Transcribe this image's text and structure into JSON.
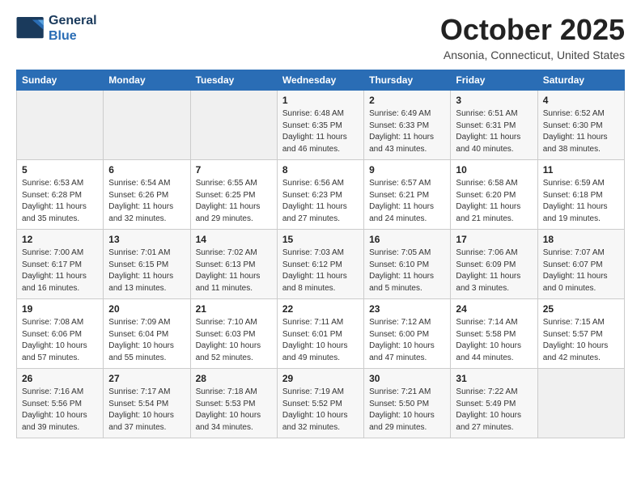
{
  "header": {
    "logo_line1": "General",
    "logo_line2": "Blue",
    "month": "October 2025",
    "location": "Ansonia, Connecticut, United States"
  },
  "days_of_week": [
    "Sunday",
    "Monday",
    "Tuesday",
    "Wednesday",
    "Thursday",
    "Friday",
    "Saturday"
  ],
  "weeks": [
    [
      {
        "day": "",
        "info": ""
      },
      {
        "day": "",
        "info": ""
      },
      {
        "day": "",
        "info": ""
      },
      {
        "day": "1",
        "info": "Sunrise: 6:48 AM\nSunset: 6:35 PM\nDaylight: 11 hours\nand 46 minutes."
      },
      {
        "day": "2",
        "info": "Sunrise: 6:49 AM\nSunset: 6:33 PM\nDaylight: 11 hours\nand 43 minutes."
      },
      {
        "day": "3",
        "info": "Sunrise: 6:51 AM\nSunset: 6:31 PM\nDaylight: 11 hours\nand 40 minutes."
      },
      {
        "day": "4",
        "info": "Sunrise: 6:52 AM\nSunset: 6:30 PM\nDaylight: 11 hours\nand 38 minutes."
      }
    ],
    [
      {
        "day": "5",
        "info": "Sunrise: 6:53 AM\nSunset: 6:28 PM\nDaylight: 11 hours\nand 35 minutes."
      },
      {
        "day": "6",
        "info": "Sunrise: 6:54 AM\nSunset: 6:26 PM\nDaylight: 11 hours\nand 32 minutes."
      },
      {
        "day": "7",
        "info": "Sunrise: 6:55 AM\nSunset: 6:25 PM\nDaylight: 11 hours\nand 29 minutes."
      },
      {
        "day": "8",
        "info": "Sunrise: 6:56 AM\nSunset: 6:23 PM\nDaylight: 11 hours\nand 27 minutes."
      },
      {
        "day": "9",
        "info": "Sunrise: 6:57 AM\nSunset: 6:21 PM\nDaylight: 11 hours\nand 24 minutes."
      },
      {
        "day": "10",
        "info": "Sunrise: 6:58 AM\nSunset: 6:20 PM\nDaylight: 11 hours\nand 21 minutes."
      },
      {
        "day": "11",
        "info": "Sunrise: 6:59 AM\nSunset: 6:18 PM\nDaylight: 11 hours\nand 19 minutes."
      }
    ],
    [
      {
        "day": "12",
        "info": "Sunrise: 7:00 AM\nSunset: 6:17 PM\nDaylight: 11 hours\nand 16 minutes."
      },
      {
        "day": "13",
        "info": "Sunrise: 7:01 AM\nSunset: 6:15 PM\nDaylight: 11 hours\nand 13 minutes."
      },
      {
        "day": "14",
        "info": "Sunrise: 7:02 AM\nSunset: 6:13 PM\nDaylight: 11 hours\nand 11 minutes."
      },
      {
        "day": "15",
        "info": "Sunrise: 7:03 AM\nSunset: 6:12 PM\nDaylight: 11 hours\nand 8 minutes."
      },
      {
        "day": "16",
        "info": "Sunrise: 7:05 AM\nSunset: 6:10 PM\nDaylight: 11 hours\nand 5 minutes."
      },
      {
        "day": "17",
        "info": "Sunrise: 7:06 AM\nSunset: 6:09 PM\nDaylight: 11 hours\nand 3 minutes."
      },
      {
        "day": "18",
        "info": "Sunrise: 7:07 AM\nSunset: 6:07 PM\nDaylight: 11 hours\nand 0 minutes."
      }
    ],
    [
      {
        "day": "19",
        "info": "Sunrise: 7:08 AM\nSunset: 6:06 PM\nDaylight: 10 hours\nand 57 minutes."
      },
      {
        "day": "20",
        "info": "Sunrise: 7:09 AM\nSunset: 6:04 PM\nDaylight: 10 hours\nand 55 minutes."
      },
      {
        "day": "21",
        "info": "Sunrise: 7:10 AM\nSunset: 6:03 PM\nDaylight: 10 hours\nand 52 minutes."
      },
      {
        "day": "22",
        "info": "Sunrise: 7:11 AM\nSunset: 6:01 PM\nDaylight: 10 hours\nand 49 minutes."
      },
      {
        "day": "23",
        "info": "Sunrise: 7:12 AM\nSunset: 6:00 PM\nDaylight: 10 hours\nand 47 minutes."
      },
      {
        "day": "24",
        "info": "Sunrise: 7:14 AM\nSunset: 5:58 PM\nDaylight: 10 hours\nand 44 minutes."
      },
      {
        "day": "25",
        "info": "Sunrise: 7:15 AM\nSunset: 5:57 PM\nDaylight: 10 hours\nand 42 minutes."
      }
    ],
    [
      {
        "day": "26",
        "info": "Sunrise: 7:16 AM\nSunset: 5:56 PM\nDaylight: 10 hours\nand 39 minutes."
      },
      {
        "day": "27",
        "info": "Sunrise: 7:17 AM\nSunset: 5:54 PM\nDaylight: 10 hours\nand 37 minutes."
      },
      {
        "day": "28",
        "info": "Sunrise: 7:18 AM\nSunset: 5:53 PM\nDaylight: 10 hours\nand 34 minutes."
      },
      {
        "day": "29",
        "info": "Sunrise: 7:19 AM\nSunset: 5:52 PM\nDaylight: 10 hours\nand 32 minutes."
      },
      {
        "day": "30",
        "info": "Sunrise: 7:21 AM\nSunset: 5:50 PM\nDaylight: 10 hours\nand 29 minutes."
      },
      {
        "day": "31",
        "info": "Sunrise: 7:22 AM\nSunset: 5:49 PM\nDaylight: 10 hours\nand 27 minutes."
      },
      {
        "day": "",
        "info": ""
      }
    ]
  ]
}
